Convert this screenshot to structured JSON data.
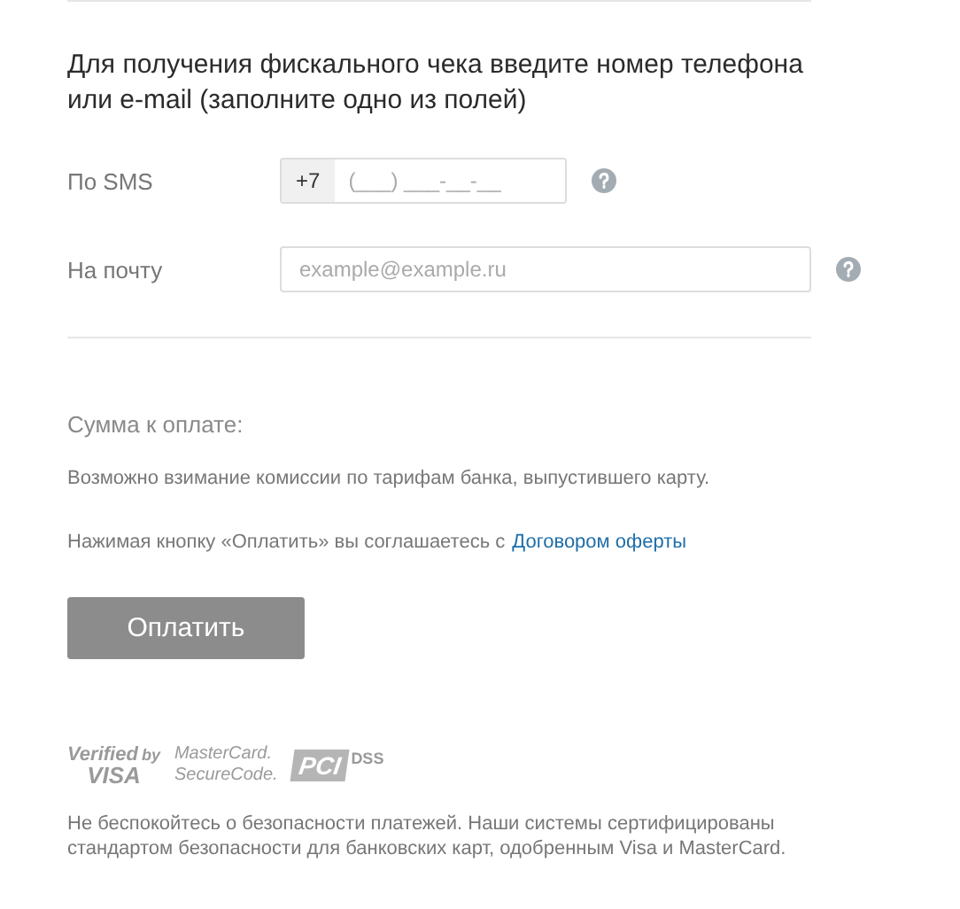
{
  "heading": "Для получения фискального чека введите номер телефона или e-mail (заполните одно из полей)",
  "fields": [
    {
      "kind": "phone",
      "label": "По SMS",
      "prefix": "+7",
      "placeholder": "(___) ___-__-__"
    },
    {
      "kind": "email",
      "label": "На почту",
      "placeholder": "example@example.ru"
    }
  ],
  "amount_label": "Сумма к оплате:",
  "commission_note": "Возможно взимание комиссии по тарифам банка, выпустившего карту.",
  "agreement": {
    "text": "Нажимая кнопку «Оплатить» вы соглашаетесь с",
    "link": "Договором оферты"
  },
  "pay_button": "Оплатить",
  "logos": {
    "visa": [
      "Verified",
      "by",
      "VISA"
    ],
    "mastercard": [
      "MasterCard.",
      "SecureCode."
    ],
    "pci": [
      "PCI",
      "DSS"
    ]
  },
  "security_note": "Не беспокойтесь о безопасности платежей. Наши системы сертифицированы стандартом безопасности для банковских карт, одобренным Visa и MasterCard."
}
